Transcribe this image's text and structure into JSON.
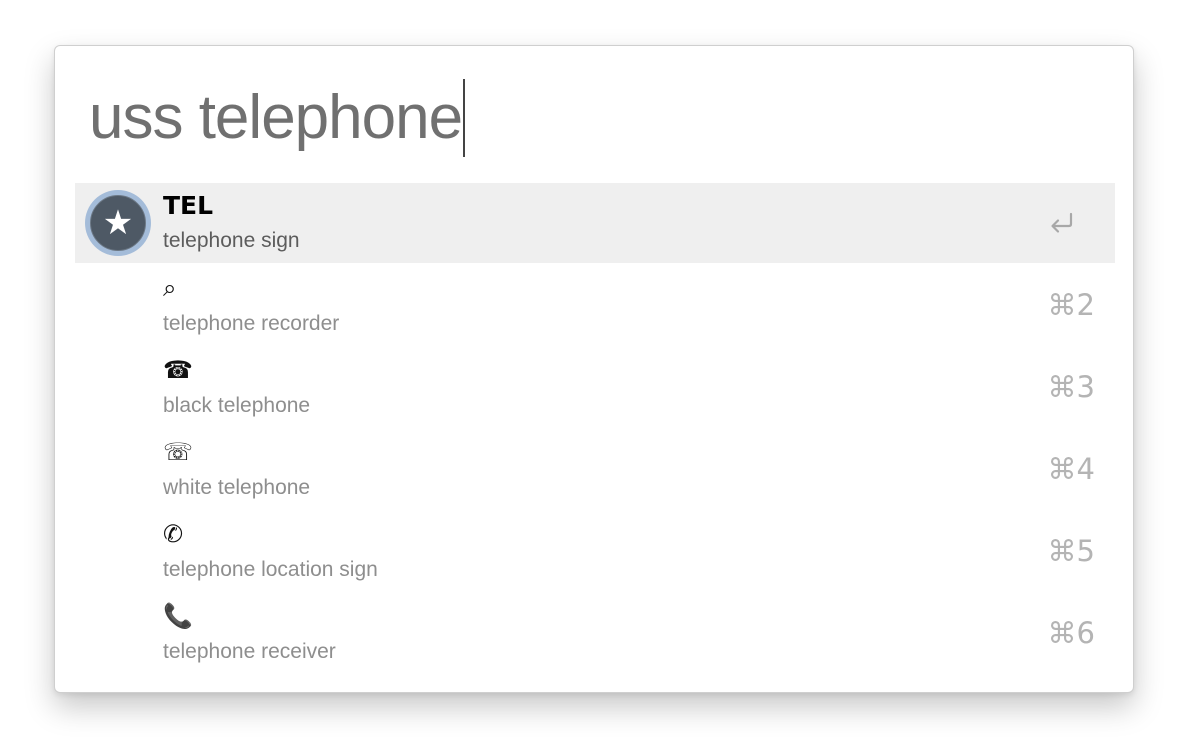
{
  "search": {
    "query": "uss telephone"
  },
  "results": [
    {
      "glyph": "TEL",
      "name": "telephone sign",
      "shortcut": "",
      "selected": true,
      "icon": "star-icon"
    },
    {
      "glyph": "⌕",
      "name": "telephone recorder",
      "shortcut": "⌘2",
      "selected": false
    },
    {
      "glyph": "☎",
      "name": "black telephone",
      "shortcut": "⌘3",
      "selected": false
    },
    {
      "glyph": "☏",
      "name": "white telephone",
      "shortcut": "⌘4",
      "selected": false
    },
    {
      "glyph": "✆",
      "name": "telephone location sign",
      "shortcut": "⌘5",
      "selected": false
    },
    {
      "glyph": "📞",
      "name": "telephone receiver",
      "shortcut": "⌘6",
      "selected": false
    }
  ],
  "icons": {
    "app_icon": "star-icon",
    "selected_action": "return-arrow-icon"
  },
  "colors": {
    "selected_row_background": "#efefef",
    "app_icon_ring": "#a4bcd9",
    "app_icon_fill": "#4e5965",
    "query_text": "#707070",
    "shortcut_text": "#b4b4b4"
  }
}
